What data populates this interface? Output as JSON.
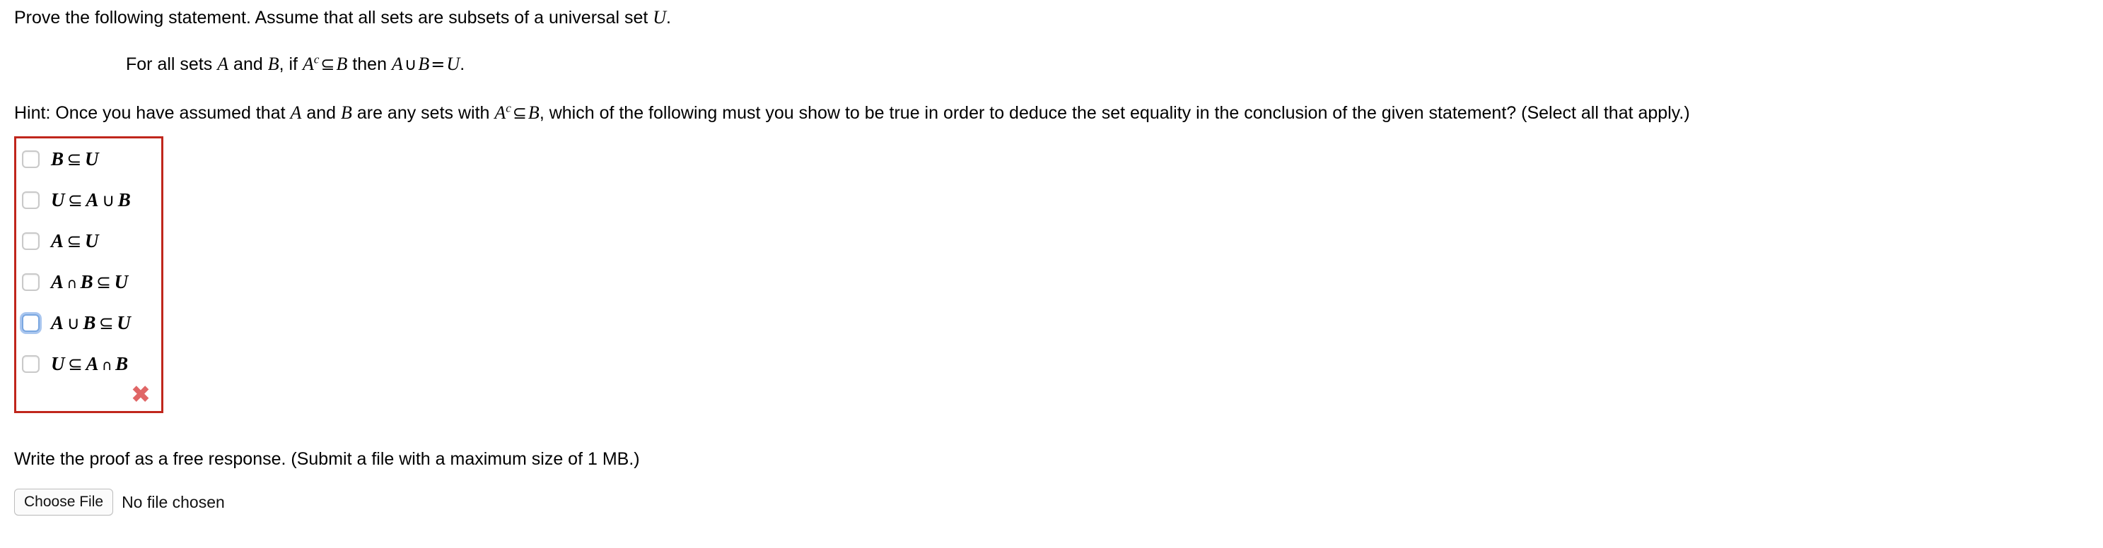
{
  "question": {
    "statement_prompt": "Prove the following statement. Assume that all sets are subsets of a universal set U.",
    "statement_prompt_parts": {
      "lead": "Prove the following statement. Assume that all sets are subsets of a universal set ",
      "universal_set": "U",
      "period": "."
    },
    "claim": {
      "full_text": "For all sets A and B, if Aᶜ ⊆ B then A ∪ B = U.",
      "p1": "For all sets ",
      "var_a1": "A",
      "p2": " and ",
      "var_b1": "B",
      "p3": ", if ",
      "var_a2": "A",
      "sup_c": "c",
      "sym_subseteq": "⊆",
      "var_b2": "B",
      "p4": " then ",
      "var_a3": "A",
      "sym_union": "∪",
      "var_b3": "B",
      "sym_equals": "=",
      "var_u": "U",
      "p5": "."
    },
    "hint": {
      "full_text": "Hint: Once you have assumed that A and B are any sets with Aᶜ ⊆ B, which of the following must you show to be true in order to deduce the set equality in the conclusion of the given statement? (Select all that apply.)",
      "h1": "Hint: Once you have assumed that ",
      "var_a1": "A",
      "h2": " and ",
      "var_b1": "B",
      "h3": " are any sets with ",
      "var_a2": "A",
      "sup_c": "c",
      "sym_subseteq": "⊆",
      "var_b2": "B",
      "h4": ", which of the following must you show to be true in order to deduce the set equality in the conclusion of the given statement? (Select all that apply.)"
    }
  },
  "answer_box": {
    "border_color": "#c0261c",
    "status": "incorrect",
    "wrong_mark_glyph": "✖",
    "wrong_mark_color": "#e06666",
    "focus_ring_color": "#a9c6ef",
    "options": [
      {
        "id": "option-1",
        "text": "B ⊆ U",
        "checked": false,
        "focused": false,
        "tokens": [
          {
            "t": "B",
            "k": "var"
          },
          {
            "t": "⊆",
            "k": "op"
          },
          {
            "t": "U",
            "k": "var"
          }
        ]
      },
      {
        "id": "option-2",
        "text": "U ⊆ A ∪ B",
        "checked": false,
        "focused": false,
        "tokens": [
          {
            "t": "U",
            "k": "var"
          },
          {
            "t": "⊆",
            "k": "op"
          },
          {
            "t": "A",
            "k": "var"
          },
          {
            "t": "∪",
            "k": "op"
          },
          {
            "t": "B",
            "k": "var"
          }
        ]
      },
      {
        "id": "option-3",
        "text": "A ⊆ U",
        "checked": false,
        "focused": false,
        "tokens": [
          {
            "t": "A",
            "k": "var"
          },
          {
            "t": "⊆",
            "k": "op"
          },
          {
            "t": "U",
            "k": "var"
          }
        ]
      },
      {
        "id": "option-4",
        "text": "A ∩ B ⊆ U",
        "checked": false,
        "focused": false,
        "tokens": [
          {
            "t": "A",
            "k": "var"
          },
          {
            "t": "∩",
            "k": "op-small"
          },
          {
            "t": "B",
            "k": "var"
          },
          {
            "t": "⊆",
            "k": "op"
          },
          {
            "t": "U",
            "k": "var"
          }
        ]
      },
      {
        "id": "option-5",
        "text": "A ∪ B ⊆ U",
        "checked": false,
        "focused": true,
        "tokens": [
          {
            "t": "A",
            "k": "var"
          },
          {
            "t": "∪",
            "k": "op"
          },
          {
            "t": "B",
            "k": "var"
          },
          {
            "t": "⊆",
            "k": "op"
          },
          {
            "t": "U",
            "k": "var"
          }
        ]
      },
      {
        "id": "option-6",
        "text": "U ⊆ A ∩ B",
        "checked": false,
        "focused": false,
        "tokens": [
          {
            "t": "U",
            "k": "var"
          },
          {
            "t": "⊆",
            "k": "op"
          },
          {
            "t": "A",
            "k": "var"
          },
          {
            "t": "∩",
            "k": "op-small"
          },
          {
            "t": "B",
            "k": "var"
          }
        ]
      }
    ]
  },
  "free_response": {
    "prompt": "Write the proof as a free response. (Submit a file with a maximum size of 1 MB.)",
    "choose_file_label": "Choose File",
    "file_status": "No file chosen"
  }
}
